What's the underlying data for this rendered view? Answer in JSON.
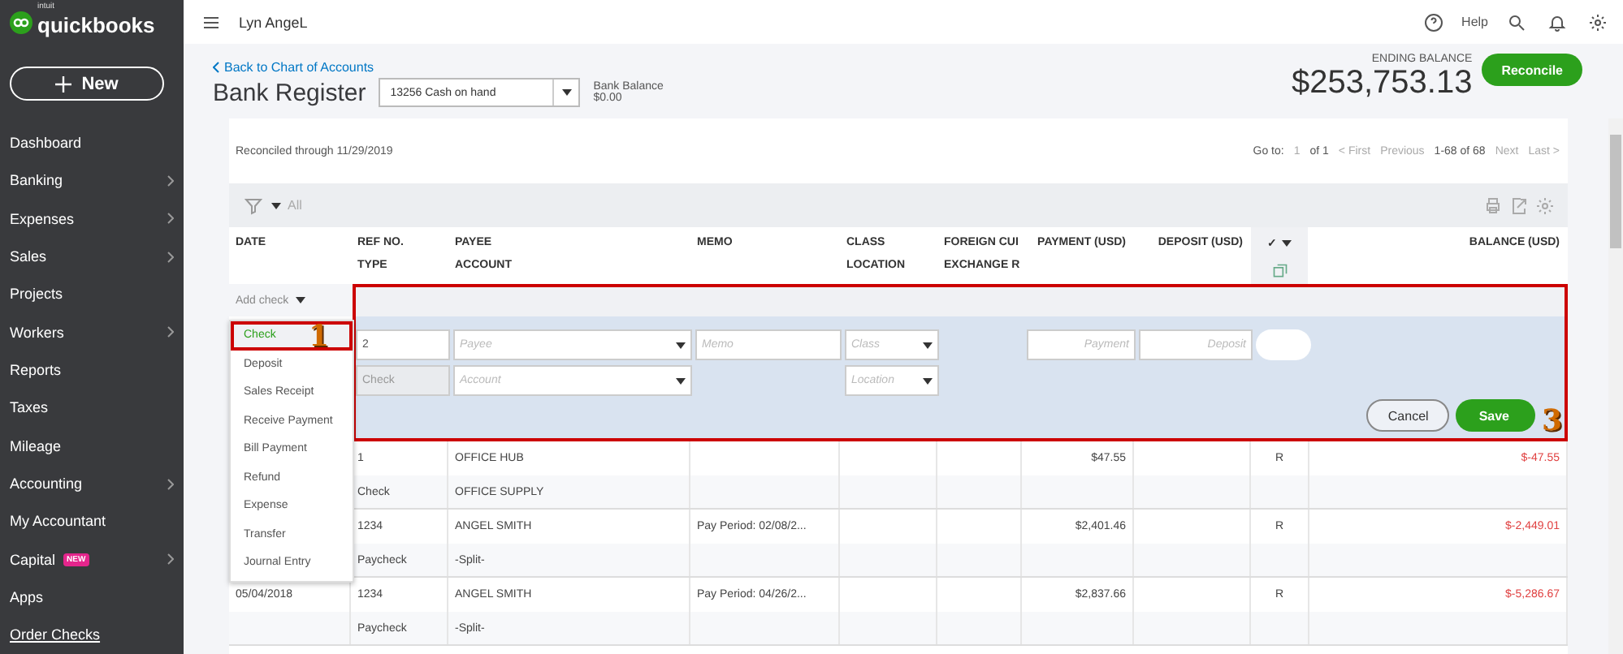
{
  "logo": {
    "brand": "intuit",
    "name": "quickbooks"
  },
  "new_button": {
    "label": "New"
  },
  "sidebar": {
    "items": [
      {
        "label": "Dashboard",
        "chevron": false,
        "link": false
      },
      {
        "label": "Banking",
        "chevron": true,
        "link": false
      },
      {
        "label": "Expenses",
        "chevron": true,
        "link": false
      },
      {
        "label": "Sales",
        "chevron": true,
        "link": false
      },
      {
        "label": "Projects",
        "chevron": false,
        "link": false
      },
      {
        "label": "Workers",
        "chevron": true,
        "link": false
      },
      {
        "label": "Reports",
        "chevron": false,
        "link": false
      },
      {
        "label": "Taxes",
        "chevron": false,
        "link": false
      },
      {
        "label": "Mileage",
        "chevron": false,
        "link": false
      },
      {
        "label": "Accounting",
        "chevron": true,
        "link": false
      },
      {
        "label": "My Accountant",
        "chevron": false,
        "link": false
      },
      {
        "label": "Capital",
        "chevron": true,
        "link": false,
        "badge": "NEW"
      },
      {
        "label": "Apps",
        "chevron": false,
        "link": false
      },
      {
        "label": "Order Checks",
        "chevron": false,
        "link": true
      }
    ]
  },
  "topbar": {
    "company": "Lyn AngeL",
    "help": "Help"
  },
  "header": {
    "back_link": "Back to Chart of Accounts",
    "title": "Bank Register",
    "account_select": "13256 Cash on hand",
    "bank_balance_label": "Bank Balance",
    "bank_balance": "$0.00",
    "ending_balance_label": "ENDING BALANCE",
    "ending_balance": "$253,753.13",
    "reconcile_button": "Reconcile"
  },
  "reconciled": "Reconciled through 11/29/2019",
  "pagination": {
    "goto_label": "Go to:",
    "page": "1",
    "of": "of 1",
    "first": "< First",
    "previous": "Previous",
    "range": "1-68 of 68",
    "next": "Next",
    "last": "Last >"
  },
  "filter": {
    "label": "All"
  },
  "table": {
    "columns": [
      {
        "lines": [
          "DATE"
        ],
        "kind": "text"
      },
      {
        "lines": [
          "REF NO.",
          "TYPE"
        ],
        "kind": "text"
      },
      {
        "lines": [
          "PAYEE",
          "ACCOUNT"
        ],
        "kind": "text"
      },
      {
        "lines": [
          "MEMO"
        ],
        "kind": "text"
      },
      {
        "lines": [
          "CLASS",
          "LOCATION"
        ],
        "kind": "text"
      },
      {
        "lines": [
          "FOREIGN CUI",
          "EXCHANGE R"
        ],
        "kind": "text"
      },
      {
        "lines": [
          "PAYMENT (USD)"
        ],
        "kind": "amount"
      },
      {
        "lines": [
          "DEPOSIT (USD)"
        ],
        "kind": "amount"
      },
      {
        "lines": [
          "✓"
        ],
        "kind": "check"
      },
      {
        "lines": [
          "BALANCE (USD)"
        ],
        "kind": "amount"
      }
    ],
    "add_menu": {
      "label": "Add check",
      "items": [
        {
          "label": "Check",
          "selected": true
        },
        {
          "label": "Deposit",
          "selected": false
        },
        {
          "label": "Sales Receipt",
          "selected": false
        },
        {
          "label": "Receive Payment",
          "selected": false
        },
        {
          "label": "Bill Payment",
          "selected": false
        },
        {
          "label": "Refund",
          "selected": false
        },
        {
          "label": "Expense",
          "selected": false
        },
        {
          "label": "Transfer",
          "selected": false
        },
        {
          "label": "Journal Entry",
          "selected": false
        }
      ]
    },
    "edit_row": {
      "ref": "2",
      "type": "Check",
      "payee_placeholder": "Payee",
      "account_placeholder": "Account",
      "memo_placeholder": "Memo",
      "class_placeholder": "Class",
      "location_placeholder": "Location",
      "payment_placeholder": "Payment",
      "deposit_placeholder": "Deposit",
      "cancel": "Cancel",
      "save": "Save"
    },
    "rows": [
      {
        "ref": "1",
        "type": "Check",
        "payee": "OFFICE HUB",
        "account": "OFFICE SUPPLY",
        "payment": "$47.55",
        "status": "R",
        "balance": "$-47.55"
      },
      {
        "ref": "1234",
        "type": "Paycheck",
        "payee": "ANGEL SMITH",
        "account": "-Split-",
        "memo": "Pay Period: 02/08/2...",
        "payment": "$2,401.46",
        "status": "R",
        "balance": "$-2,449.01"
      },
      {
        "date": "05/04/2018",
        "ref": "1234",
        "type": "Paycheck",
        "payee": "ANGEL SMITH",
        "account": "-Split-",
        "memo": "Pay Period: 04/26/2...",
        "payment": "$2,837.66",
        "status": "R",
        "balance": "$-5,286.67"
      }
    ]
  },
  "annotations": [
    "1",
    "3"
  ]
}
